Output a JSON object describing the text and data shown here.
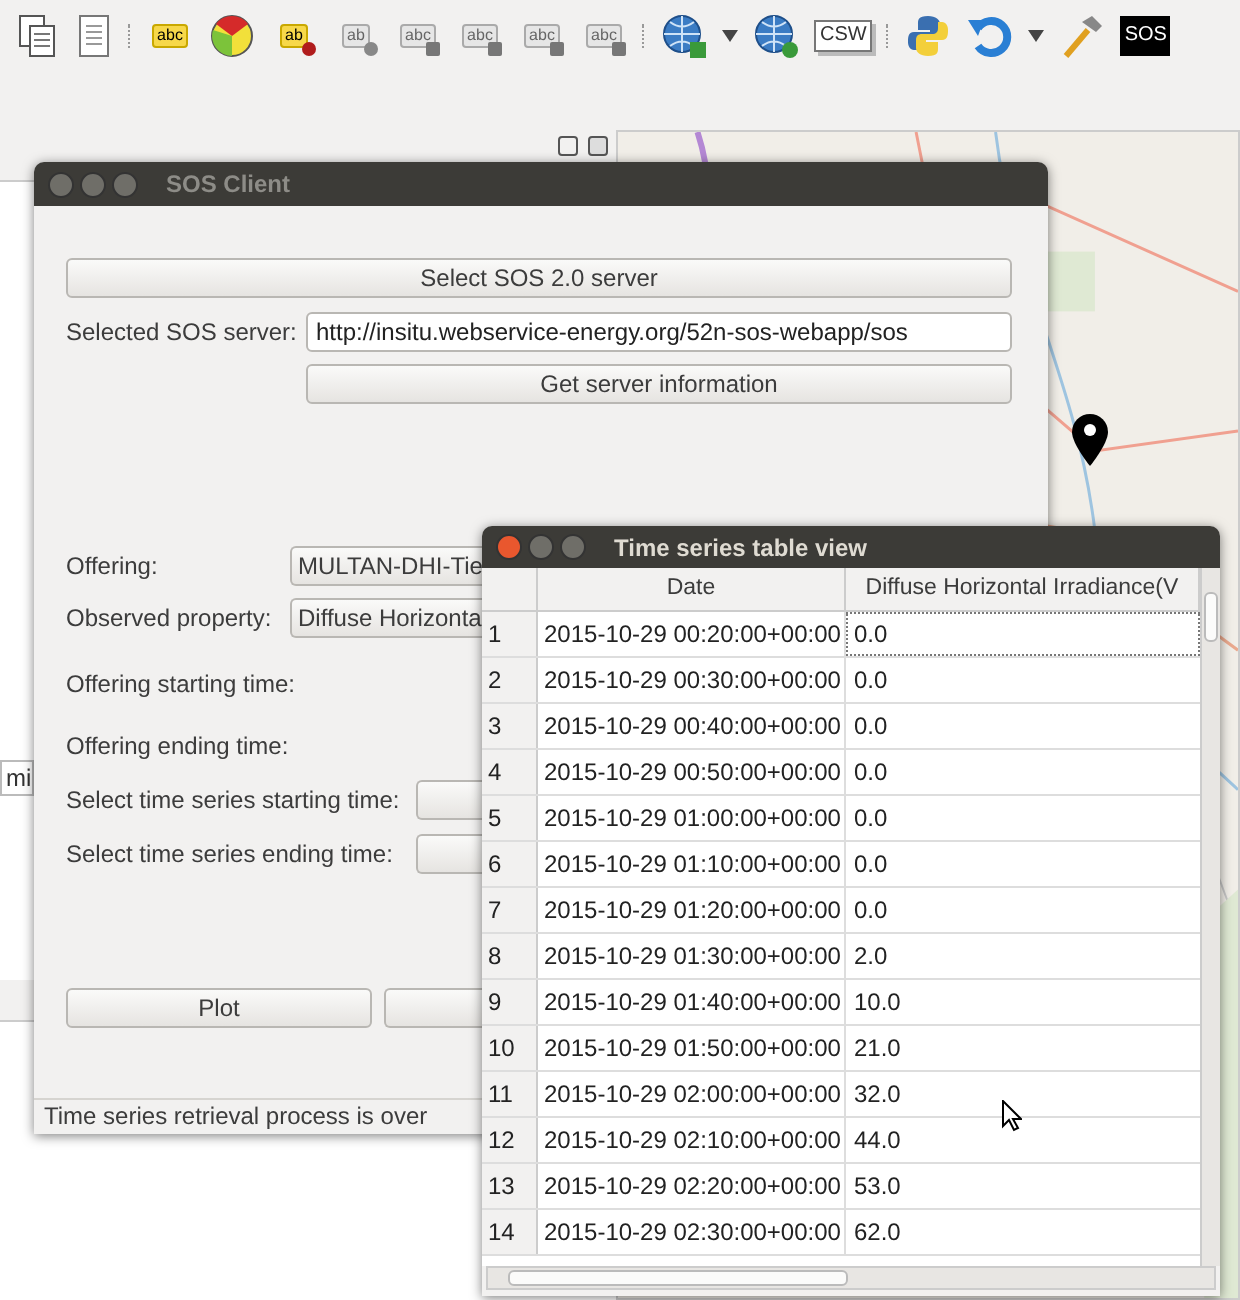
{
  "toolbar": [
    {
      "kind": "copy"
    },
    {
      "kind": "paste"
    },
    {
      "kind": "separator"
    },
    {
      "kind": "label-tag",
      "label": "abc"
    },
    {
      "kind": "pie"
    },
    {
      "kind": "label-pin",
      "label": "ab"
    },
    {
      "kind": "label-dot",
      "label": "ab"
    },
    {
      "kind": "label-eye",
      "label": "abc"
    },
    {
      "kind": "label-move",
      "label": "abc"
    },
    {
      "kind": "label-rotate",
      "label": "abc"
    },
    {
      "kind": "label-edit",
      "label": "abc"
    },
    {
      "kind": "separator"
    },
    {
      "kind": "globe-add"
    },
    {
      "kind": "caret"
    },
    {
      "kind": "globe-search"
    },
    {
      "kind": "text-box",
      "label": "CSW"
    },
    {
      "kind": "separator"
    },
    {
      "kind": "python"
    },
    {
      "kind": "undo"
    },
    {
      "kind": "caret"
    },
    {
      "kind": "hammer"
    },
    {
      "kind": "dark-box",
      "label": "SOS"
    }
  ],
  "side_field": {
    "value": "mi"
  },
  "sos_window": {
    "title": "SOS Client",
    "select_server_button": "Select SOS 2.0 server",
    "server_label": "Selected SOS server:",
    "server_url": "http://insitu.webservice-energy.org/52n-sos-webapp/sos",
    "info_button": "Get server information",
    "offering_label": "Offering:",
    "offering_value": "MULTAN-DHI-Tie",
    "property_label": "Observed property:",
    "property_value": "Diffuse Horizonta",
    "offering_start_label": "Offering starting time:",
    "offering_end_label": "Offering ending time:",
    "series_start_label": "Select time series starting time:",
    "series_end_label": "Select time series ending time:",
    "plot_button": "Plot",
    "status": "Time series retrieval process is over"
  },
  "table_window": {
    "title": "Time series table view",
    "columns": [
      "Date",
      "Diffuse Horizontal Irradiance(V"
    ],
    "rows": [
      {
        "index": "1",
        "date": "2015-10-29 00:20:00+00:00",
        "value": "0.0",
        "focused": true
      },
      {
        "index": "2",
        "date": "2015-10-29 00:30:00+00:00",
        "value": "0.0",
        "focused": false
      },
      {
        "index": "3",
        "date": "2015-10-29 00:40:00+00:00",
        "value": "0.0",
        "focused": false
      },
      {
        "index": "4",
        "date": "2015-10-29 00:50:00+00:00",
        "value": "0.0",
        "focused": false
      },
      {
        "index": "5",
        "date": "2015-10-29 01:00:00+00:00",
        "value": "0.0",
        "focused": false
      },
      {
        "index": "6",
        "date": "2015-10-29 01:10:00+00:00",
        "value": "0.0",
        "focused": false
      },
      {
        "index": "7",
        "date": "2015-10-29 01:20:00+00:00",
        "value": "0.0",
        "focused": false
      },
      {
        "index": "8",
        "date": "2015-10-29 01:30:00+00:00",
        "value": "2.0",
        "focused": false
      },
      {
        "index": "9",
        "date": "2015-10-29 01:40:00+00:00",
        "value": "10.0",
        "focused": false
      },
      {
        "index": "10",
        "date": "2015-10-29 01:50:00+00:00",
        "value": "21.0",
        "focused": false
      },
      {
        "index": "11",
        "date": "2015-10-29 02:00:00+00:00",
        "value": "32.0",
        "focused": false
      },
      {
        "index": "12",
        "date": "2015-10-29 02:10:00+00:00",
        "value": "44.0",
        "focused": false
      },
      {
        "index": "13",
        "date": "2015-10-29 02:20:00+00:00",
        "value": "53.0",
        "focused": false
      },
      {
        "index": "14",
        "date": "2015-10-29 02:30:00+00:00",
        "value": "62.0",
        "focused": false
      }
    ]
  }
}
